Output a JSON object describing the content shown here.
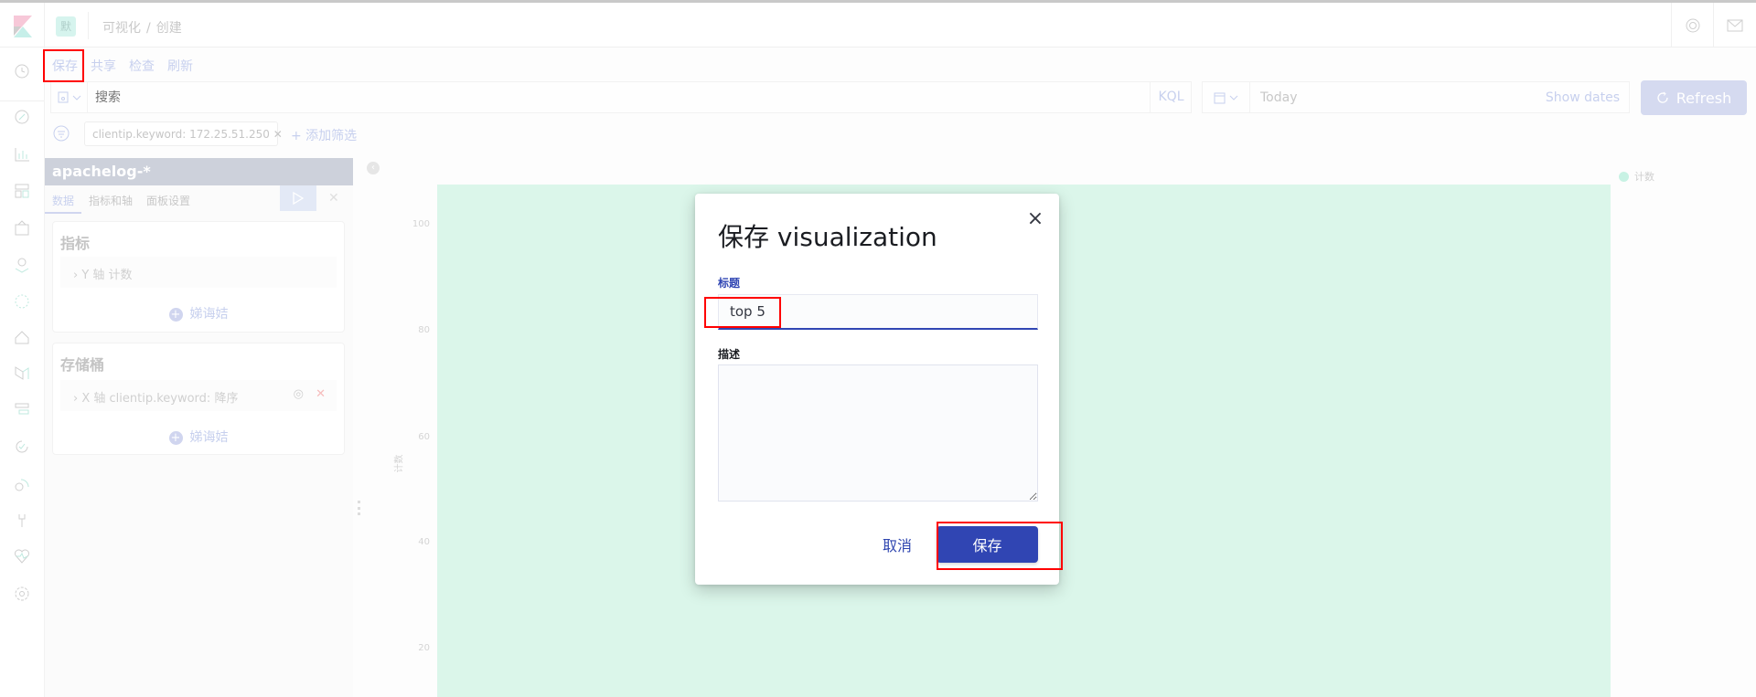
{
  "header": {
    "space_initial": "默",
    "breadcrumbs": [
      "可视化",
      "/",
      "创建"
    ]
  },
  "toolbar": {
    "save": "保存",
    "share": "共享",
    "inspect": "检查",
    "refresh": "刷新"
  },
  "query": {
    "placeholder": "搜索",
    "language": "KQL",
    "date": "Today",
    "show_dates": "Show dates",
    "refresh_button": "Refresh"
  },
  "filters": {
    "pill": "clientip.keyword: 172.25.51.250",
    "add": "+ 添加筛选"
  },
  "sidebar": {
    "index_pattern": "apachelog-*",
    "tabs": [
      "数据",
      "指标和轴",
      "面板设置"
    ],
    "metrics": {
      "title": "指标",
      "row": "Y 轴 计数",
      "add": "娣诲姞"
    },
    "buckets": {
      "title": "存储桶",
      "row": "X 轴 clientip.keyword: 降序",
      "add": "娣诲姞"
    }
  },
  "chart": {
    "y_ticks": [
      "100",
      "80",
      "60",
      "40",
      "20"
    ],
    "y_label": "计数",
    "legend": "计数",
    "bar_color": "#dbf6ea"
  },
  "modal": {
    "title": "保存 visualization",
    "title_label": "标题",
    "title_value": "top 5",
    "description_label": "描述",
    "description_value": "",
    "cancel": "取消",
    "save": "保存",
    "accent": "#3045b3"
  }
}
